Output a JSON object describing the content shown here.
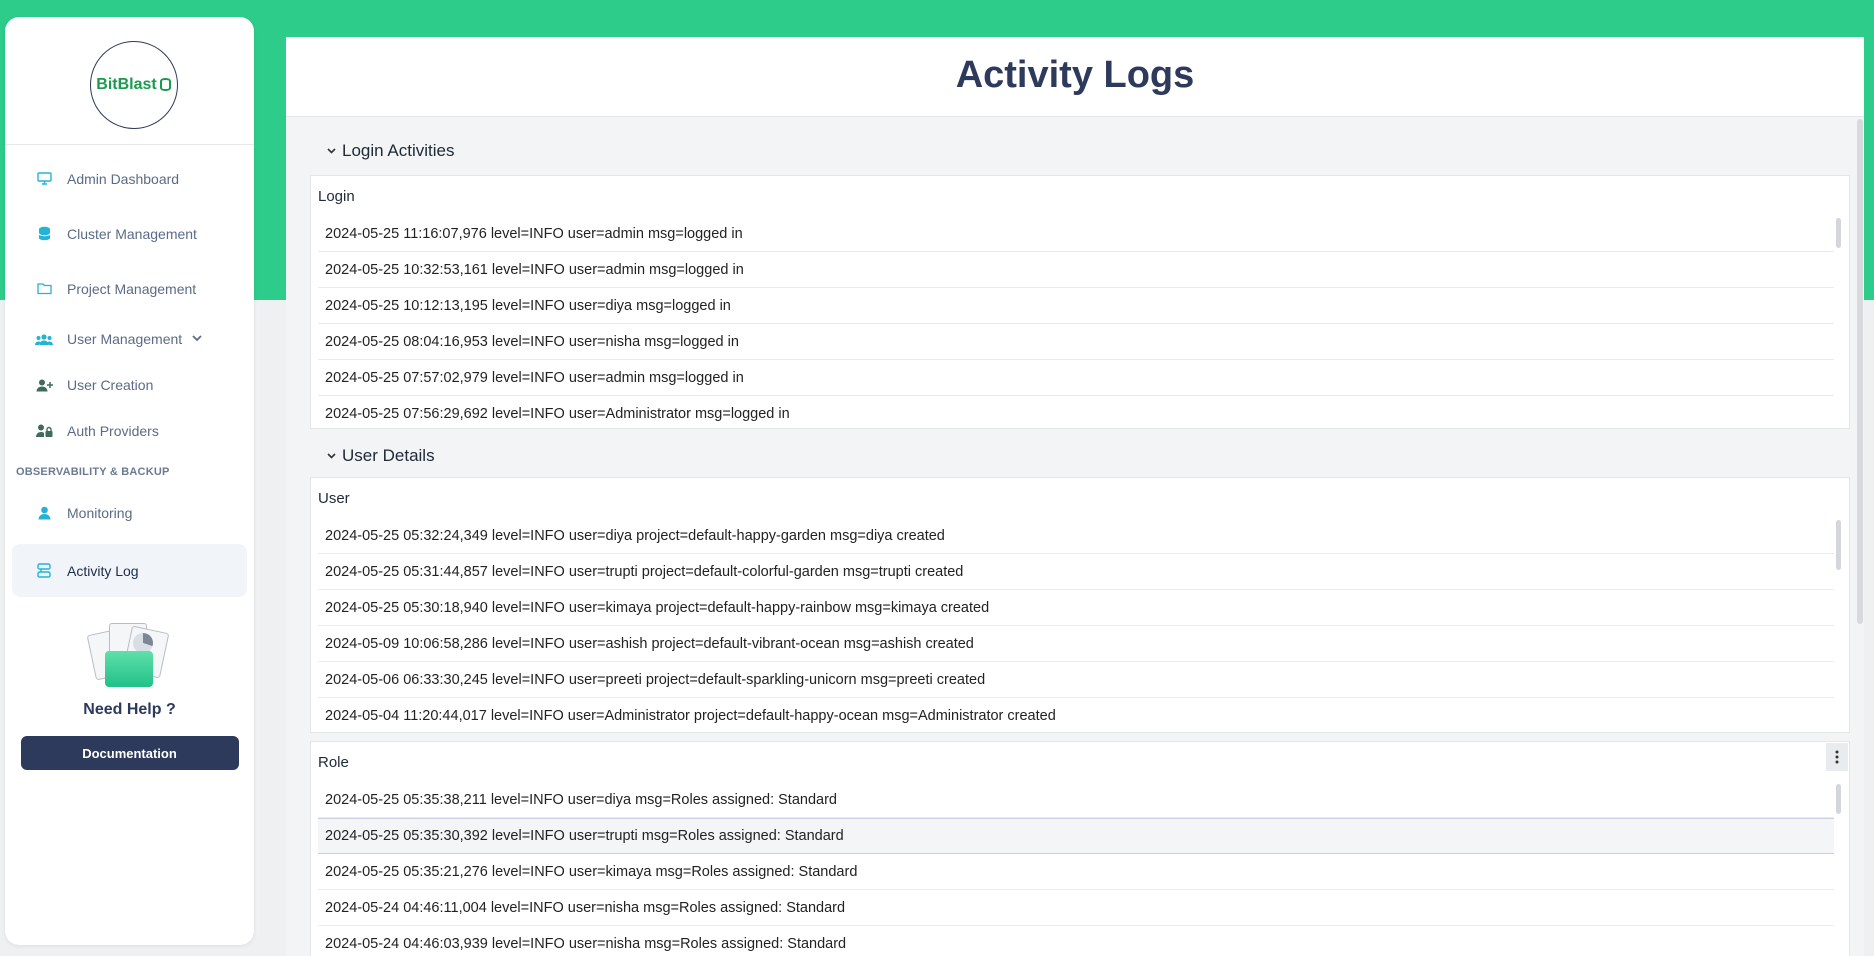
{
  "brand": {
    "logo_text": "BitBlast"
  },
  "sidebar": {
    "items": [
      {
        "label": "Admin Dashboard",
        "icon": "monitor-icon"
      },
      {
        "label": "Cluster Management",
        "icon": "database-icon"
      },
      {
        "label": "Project Management",
        "icon": "folder-icon"
      },
      {
        "label": "User Management",
        "icon": "users-icon"
      },
      {
        "label": "User Creation",
        "icon": "user-plus-icon"
      },
      {
        "label": "Auth Providers",
        "icon": "user-lock-icon"
      }
    ],
    "section_label": "OBSERVABILITY & BACKUP",
    "obs_items": [
      {
        "label": "Monitoring",
        "icon": "user-icon"
      },
      {
        "label": "Activity Log",
        "icon": "activity-log-icon"
      }
    ],
    "help_title": "Need Help ?",
    "doc_button": "Documentation"
  },
  "page": {
    "title": "Activity Logs"
  },
  "sections": {
    "login": {
      "heading": "Login Activities",
      "card_title": "Login",
      "rows": [
        "2024-05-25 11:16:07,976 level=INFO user=admin msg=logged in",
        "2024-05-25 10:32:53,161 level=INFO user=admin msg=logged in",
        "2024-05-25 10:12:13,195 level=INFO user=diya msg=logged in",
        "2024-05-25 08:04:16,953 level=INFO user=nisha msg=logged in",
        "2024-05-25 07:57:02,979 level=INFO user=admin msg=logged in",
        "2024-05-25 07:56:29,692 level=INFO user=Administrator msg=logged in"
      ]
    },
    "user_details": {
      "heading": "User Details",
      "user_card": {
        "title": "User",
        "rows": [
          "2024-05-25 05:32:24,349 level=INFO user=diya project=default-happy-garden msg=diya created",
          "2024-05-25 05:31:44,857 level=INFO user=trupti project=default-colorful-garden msg=trupti created",
          "2024-05-25 05:30:18,940 level=INFO user=kimaya project=default-happy-rainbow msg=kimaya created",
          "2024-05-09 10:06:58,286 level=INFO user=ashish project=default-vibrant-ocean msg=ashish created",
          "2024-05-06 06:33:30,245 level=INFO user=preeti project=default-sparkling-unicorn msg=preeti created",
          "2024-05-04 11:20:44,017 level=INFO user=Administrator project=default-happy-ocean msg=Administrator created"
        ]
      },
      "role_card": {
        "title": "Role",
        "menu_icon": "kebab-menu-icon",
        "rows": [
          "2024-05-25 05:35:38,211 level=INFO user=diya msg=Roles assigned: Standard",
          "2024-05-25 05:35:30,392 level=INFO user=trupti msg=Roles assigned: Standard",
          "2024-05-25 05:35:21,276 level=INFO user=kimaya msg=Roles assigned: Standard",
          "2024-05-24 04:46:11,004 level=INFO user=nisha msg=Roles assigned: Standard",
          "2024-05-24 04:46:03,939 level=INFO user=nisha msg=Roles assigned: Standard"
        ]
      }
    }
  },
  "colors": {
    "accent_green": "#2ecc8a",
    "navy": "#2d3a5c",
    "icon_cyan": "#24b3d6"
  }
}
